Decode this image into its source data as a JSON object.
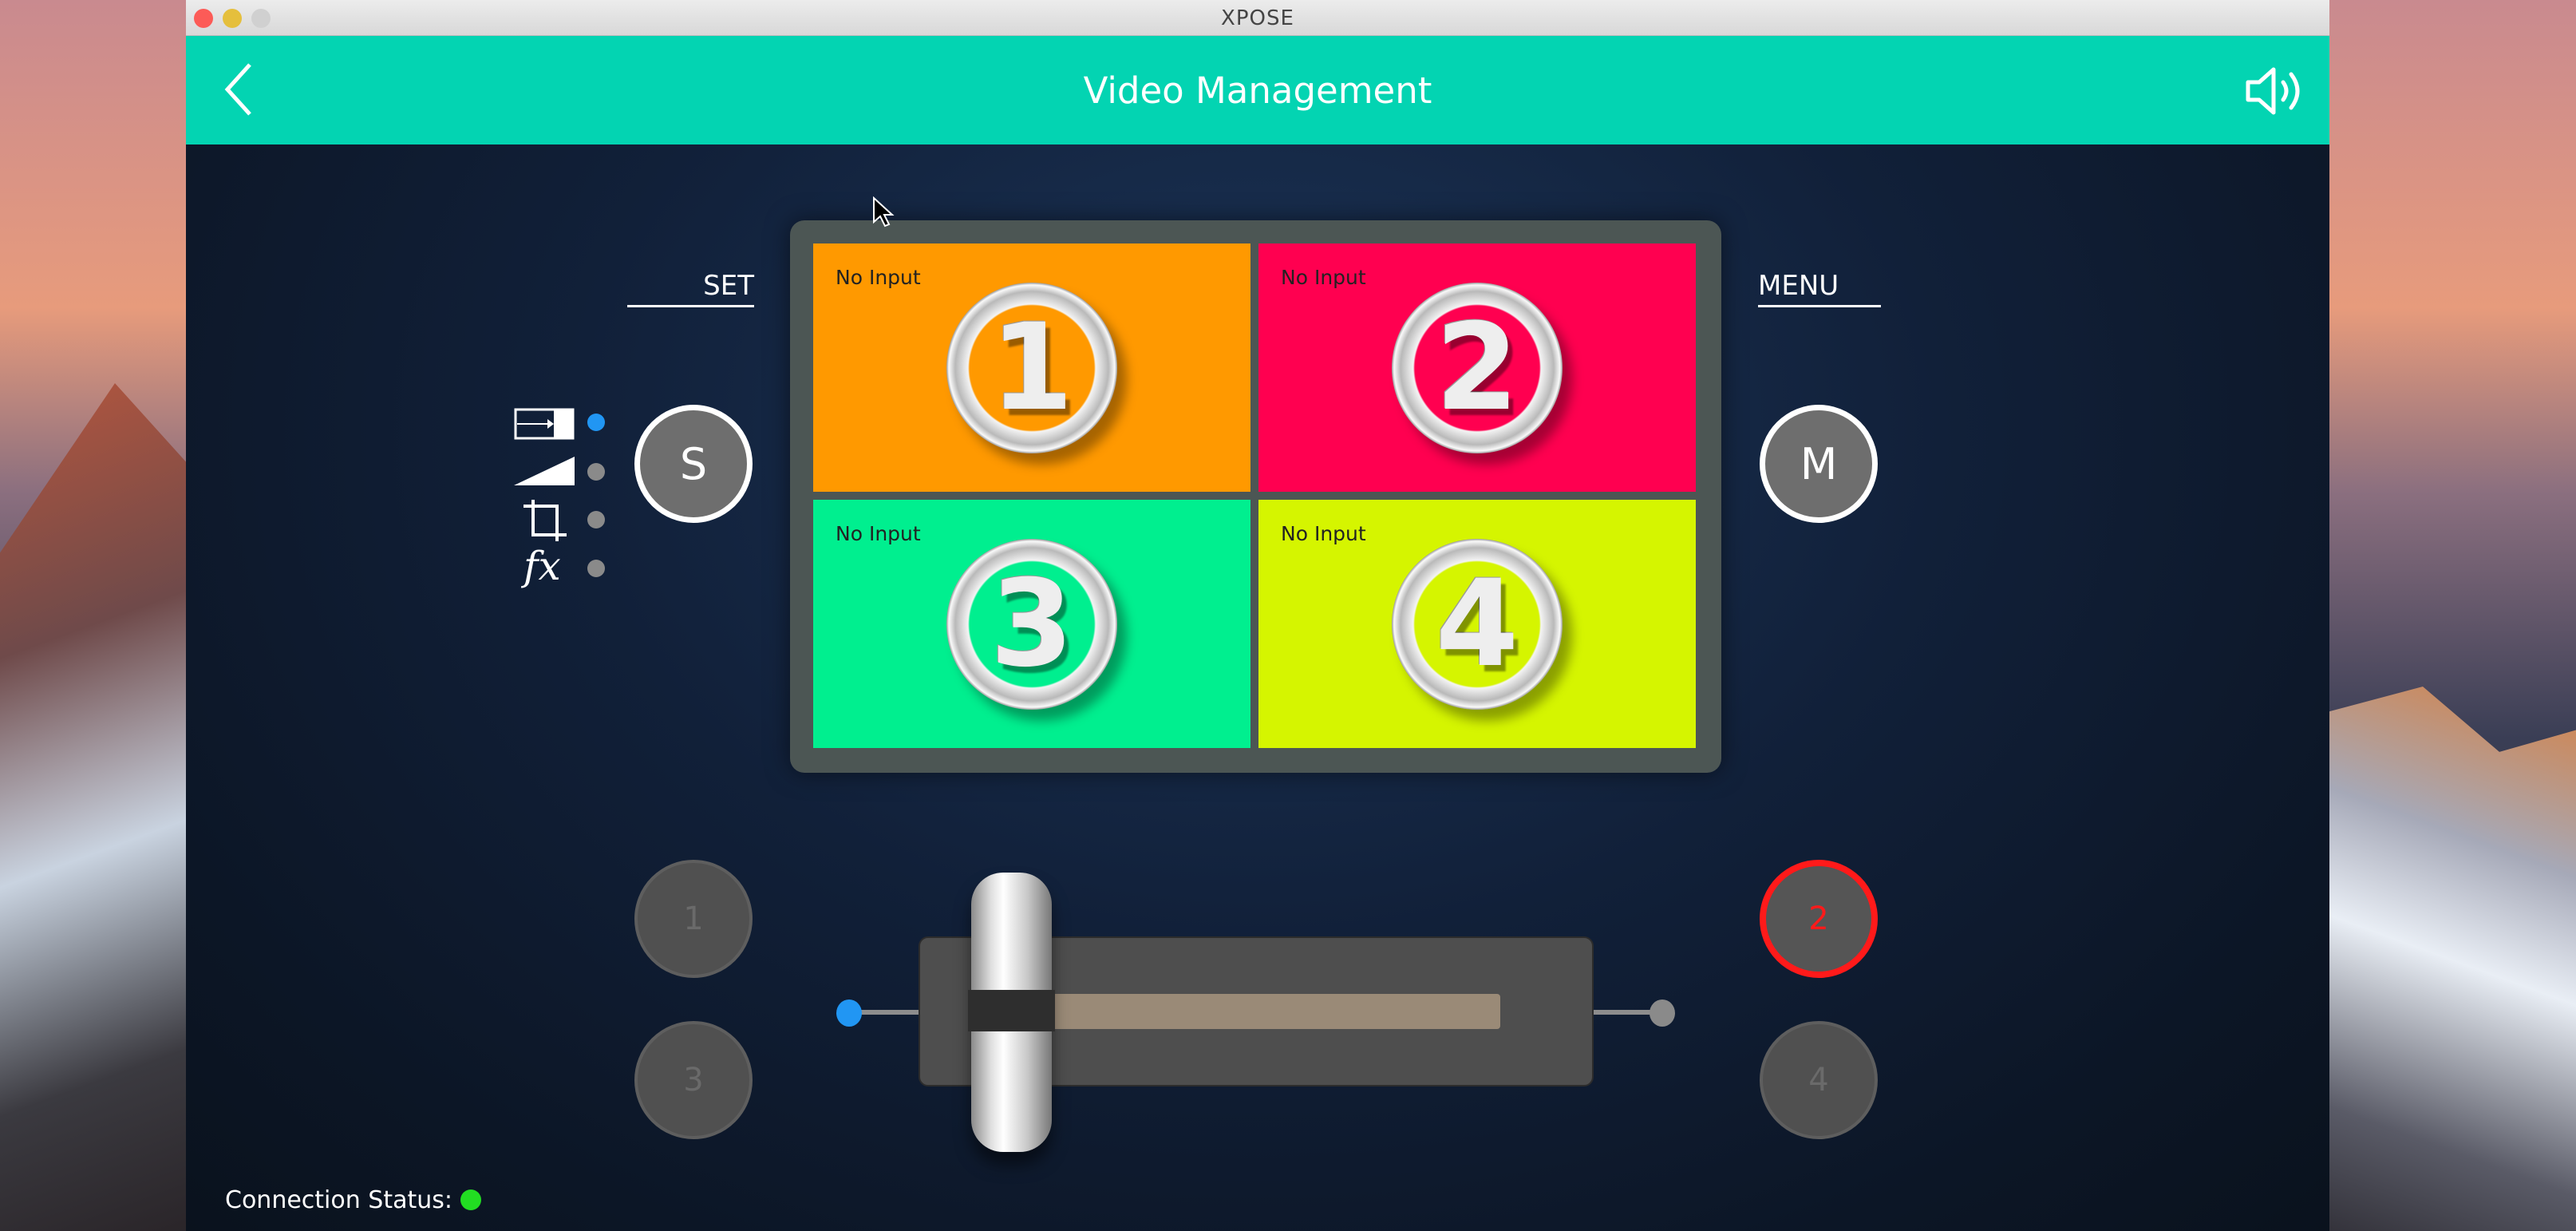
{
  "window": {
    "title": "XPOSE"
  },
  "header": {
    "title": "Video Management",
    "back_icon": "chevron-left-icon",
    "sound_icon": "speaker-icon"
  },
  "set": {
    "label": "SET",
    "button": "S",
    "modes": [
      {
        "icon": "transition-wipe-icon",
        "active": true
      },
      {
        "icon": "volume-ramp-icon",
        "active": false
      },
      {
        "icon": "crop-icon",
        "active": false
      },
      {
        "icon": "fx-icon",
        "active": false
      }
    ]
  },
  "menu": {
    "label": "MENU",
    "button": "M"
  },
  "preview": {
    "tiles": [
      {
        "number": "1",
        "status": "No Input",
        "color": "#ff9900"
      },
      {
        "number": "2",
        "status": "No Input",
        "color": "#ff0050"
      },
      {
        "number": "3",
        "status": "No Input",
        "color": "#00ef8f"
      },
      {
        "number": "4",
        "status": "No Input",
        "color": "#d5f500"
      }
    ]
  },
  "inputs": {
    "left": [
      "1",
      "3"
    ],
    "right": [
      "2",
      "4"
    ],
    "active": "2"
  },
  "crossfader": {
    "position": 0
  },
  "status": {
    "label": "Connection Status:",
    "connected": true,
    "color": "#22dd22"
  },
  "colors": {
    "accent": "#03d4b2",
    "active_dot": "#2196f3",
    "active_input": "#ff1a1a"
  }
}
